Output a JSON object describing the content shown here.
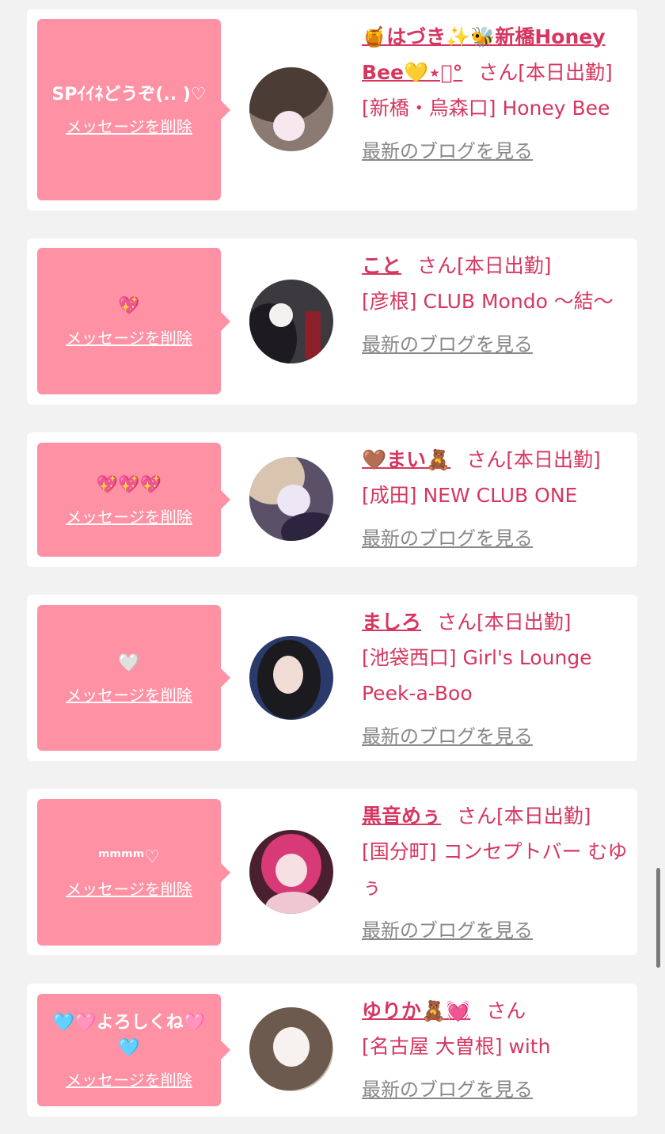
{
  "delete_label": "メッセージを削除",
  "blog_label": "最新のブログを見る",
  "cards": [
    {
      "message": "SPｲｲﾈどうぞ(.. )♡",
      "name": "🍯はづき✨🐝新橋Honey Bee💛⋆͛°",
      "san": "さん",
      "status": "[本日出勤]",
      "shop": "[新橋・烏森口] Honey Bee"
    },
    {
      "message": "💖",
      "name": "こと",
      "san": "さん",
      "status": "[本日出勤]",
      "shop": "[彦根] CLUB Mondo 〜結〜"
    },
    {
      "message": "💖💖💖",
      "name": "🤎まい🧸",
      "san": "さん",
      "status": "[本日出勤]",
      "shop": "[成田] NEW CLUB ONE"
    },
    {
      "message": "🤍",
      "name": "ましろ",
      "san": "さん",
      "status": "[本日出勤]",
      "shop": "[池袋西口] Girl's Lounge Peek-a-Boo"
    },
    {
      "message": "ᵐᵐᵐᵐ♡",
      "name": "黒音めぅ",
      "san": "さん",
      "status": "[本日出勤]",
      "shop": "[国分町] コンセプトバー むゆぅ"
    },
    {
      "message": "🩵🩷よろしくね🩷🩵",
      "name": "ゆりか🧸💓",
      "san": "さん",
      "status": "",
      "shop": "[名古屋 大曽根] with"
    }
  ],
  "colors": {
    "accent": "#d6365f",
    "bubble": "#fe91a4",
    "link_gray": "#888888",
    "background": "#f2f2f3"
  }
}
